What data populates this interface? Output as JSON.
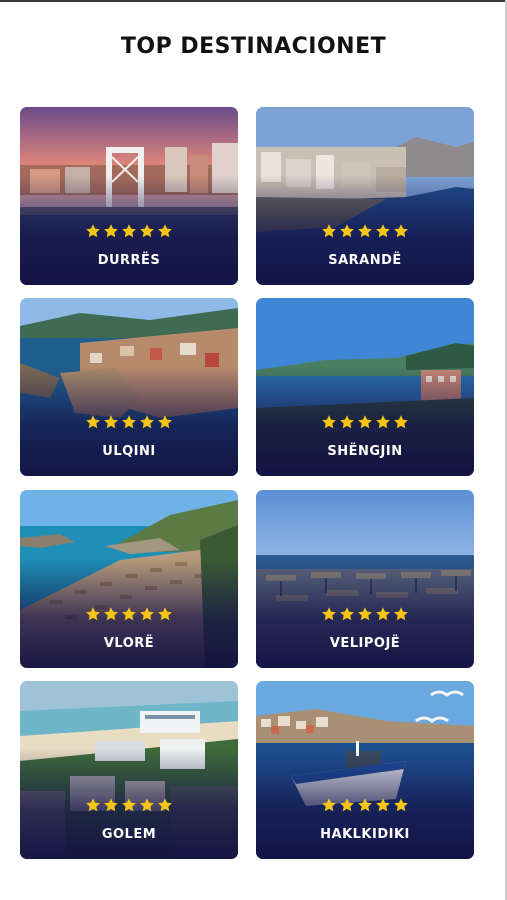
{
  "page": {
    "title": "TOP DESTINACIONET"
  },
  "rating_max": 5,
  "destinations": [
    {
      "name": "DURRËS",
      "rating": 5,
      "scene": "bridge-sunset"
    },
    {
      "name": "SARANDË",
      "rating": 5,
      "scene": "coastal-city"
    },
    {
      "name": "ULQINI",
      "rating": 5,
      "scene": "old-town-peninsula"
    },
    {
      "name": "SHËNGJIN",
      "rating": 5,
      "scene": "bay-hills"
    },
    {
      "name": "VLORË",
      "rating": 5,
      "scene": "beach-umbrellas-cliff"
    },
    {
      "name": "VELIPOJË",
      "rating": 5,
      "scene": "beach-umbrellas-dusk"
    },
    {
      "name": "GOLEM",
      "rating": 5,
      "scene": "resort-aerial"
    },
    {
      "name": "HAKLKIDIKI",
      "rating": 5,
      "scene": "harbor-boat-seagulls"
    }
  ],
  "colors": {
    "star": "#f5c518",
    "overlay": "#16124a",
    "title": "#111111"
  }
}
